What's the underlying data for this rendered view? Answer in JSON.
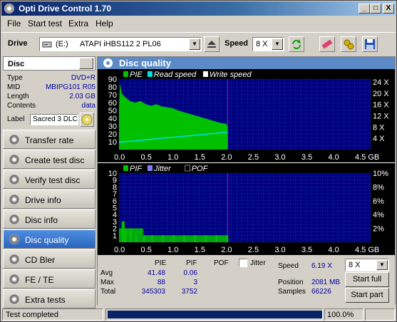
{
  "window": {
    "title": "Opti Drive Control 1.70",
    "minimize": "_",
    "maximize": "□",
    "close": "X"
  },
  "menu": [
    "File",
    "Start test",
    "Extra",
    "Help"
  ],
  "toolbar": {
    "drive_label": "Drive",
    "drive_letter": "(E:)",
    "drive_value": "ATAPI   iHBS112   2 PL06",
    "speed_label": "Speed",
    "speed_value": "8 X"
  },
  "disc": {
    "header": "Disc",
    "rows": [
      {
        "key": "Type",
        "value": "DVD+R"
      },
      {
        "key": "MID",
        "value": "MBIPG101 R05"
      },
      {
        "key": "Length",
        "value": "2.03 GB"
      },
      {
        "key": "Contents",
        "value": "data"
      }
    ],
    "label_key": "Label",
    "label_value": "Sacred 3 DLC"
  },
  "nav": [
    {
      "label": "Transfer rate",
      "name": "nav-transfer-rate",
      "active": false
    },
    {
      "label": "Create test disc",
      "name": "nav-create-test-disc",
      "active": false
    },
    {
      "label": "Verify test disc",
      "name": "nav-verify-test-disc",
      "active": false
    },
    {
      "label": "Drive info",
      "name": "nav-drive-info",
      "active": false
    },
    {
      "label": "Disc info",
      "name": "nav-disc-info",
      "active": false
    },
    {
      "label": "Disc quality",
      "name": "nav-disc-quality",
      "active": true
    },
    {
      "label": "CD Bler",
      "name": "nav-cd-bler",
      "active": false
    },
    {
      "label": "FE / TE",
      "name": "nav-fe-te",
      "active": false
    },
    {
      "label": "Extra tests",
      "name": "nav-extra-tests",
      "active": false
    }
  ],
  "main": {
    "title": "Disc quality"
  },
  "chart_data": [
    {
      "type": "area",
      "legend": [
        "PIE",
        "Read speed",
        "Write speed"
      ],
      "colors": {
        "PIE": "#00c000",
        "Read speed": "#00e0e0",
        "Write speed": "#ffffff"
      },
      "x_ticks": [
        "0.0",
        "0.5",
        "1.0",
        "1.5",
        "2.0",
        "2.5",
        "3.0",
        "3.5",
        "4.0",
        "4.5 GB"
      ],
      "y_left_ticks": [
        "90",
        "80",
        "70",
        "60",
        "50",
        "40",
        "30",
        "20",
        "10"
      ],
      "y_right_ticks": [
        "24 X",
        "20 X",
        "16 X",
        "12 X",
        "8 X",
        "4 X"
      ],
      "xlim": [
        0,
        4.7
      ],
      "ylim": [
        0,
        90
      ],
      "pie_x": [
        0.0,
        0.02,
        0.05,
        0.1,
        0.2,
        0.3,
        0.4,
        0.5,
        0.6,
        0.7,
        0.8,
        0.9,
        1.0,
        1.1,
        1.2,
        1.3,
        1.4,
        1.5,
        1.6,
        1.7,
        1.8,
        1.9,
        2.0,
        2.03
      ],
      "pie_y": [
        50,
        85,
        72,
        68,
        62,
        60,
        62,
        58,
        56,
        58,
        55,
        54,
        53,
        50,
        48,
        46,
        44,
        42,
        40,
        38,
        36,
        34,
        33,
        30
      ],
      "read_x": [
        0.0,
        2.03
      ],
      "read_y_speed": [
        2.6,
        6.2
      ]
    },
    {
      "type": "bar",
      "legend": [
        "PIF",
        "Jitter",
        "POF"
      ],
      "colors": {
        "PIF": "#00c000",
        "Jitter": "#8080ff",
        "POF": "#000000"
      },
      "x_ticks": [
        "0.0",
        "0.5",
        "1.0",
        "1.5",
        "2.0",
        "2.5",
        "3.0",
        "3.5",
        "4.0",
        "4.5 GB"
      ],
      "y_left_ticks": [
        "10",
        "9",
        "8",
        "7",
        "6",
        "5",
        "4",
        "3",
        "2",
        "1"
      ],
      "y_right_ticks": [
        "10%",
        "8%",
        "6%",
        "4%",
        "2%"
      ],
      "xlim": [
        0,
        4.7
      ],
      "ylim": [
        0,
        10
      ],
      "pif_x": [
        0.05,
        0.1,
        0.2,
        0.3,
        0.45,
        0.6,
        0.8,
        1.0,
        1.2,
        1.4,
        1.6,
        1.8,
        2.0
      ],
      "pif_y": [
        3,
        2,
        2,
        1,
        1,
        1,
        1,
        1,
        1,
        1,
        1,
        1,
        1
      ]
    }
  ],
  "stats": {
    "head_pie": "PIE",
    "head_pif": "PIF",
    "head_pof": "POF",
    "jitter_label": "Jitter",
    "avg_label": "Avg",
    "max_label": "Max",
    "total_label": "Total",
    "avg_pie": "41.48",
    "avg_pif": "0.06",
    "max_pie": "88",
    "max_pif": "3",
    "total_pie": "345303",
    "total_pif": "3752",
    "speed_label": "Speed",
    "speed_value": "6.19 X",
    "position_label": "Position",
    "position_value": "2081 MB",
    "samples_label": "Samples",
    "samples_value": "66226",
    "speed_select": "8 X",
    "start_full": "Start full",
    "start_part": "Start part"
  },
  "status": {
    "text": "Test completed",
    "progress_label": "100.0%",
    "progress": 1.0
  }
}
